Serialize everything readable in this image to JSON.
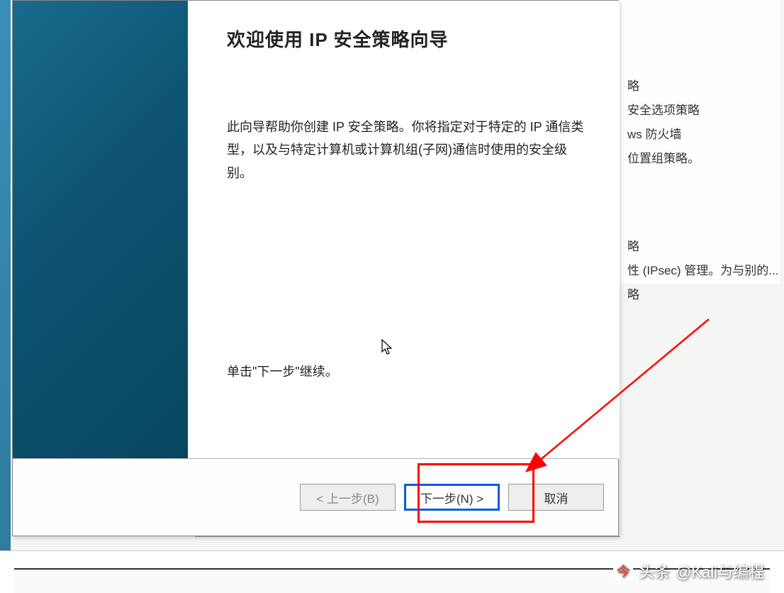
{
  "wizard": {
    "title": "欢迎使用 IP 安全策略向导",
    "description": "此向导帮助你创建 IP 安全策略。你将指定对于特定的 IP 通信类型，以及与特定计算机或计算机组(子网)通信时使用的安全级别。",
    "hint": "单击\"下一步\"继续。",
    "buttons": {
      "back_label": "< 上一步(B)",
      "next_label": "下一步(N) >",
      "cancel_label": "取消"
    }
  },
  "background_window": {
    "lines": [
      "略",
      "安全选项策略",
      "ws 防火墙",
      "位置组策略。"
    ],
    "lines2": [
      "略",
      "性 (IPsec) 管理。为与别的...",
      "略"
    ]
  },
  "attribution": {
    "platform": "头条",
    "author": "@Kali与编程"
  }
}
